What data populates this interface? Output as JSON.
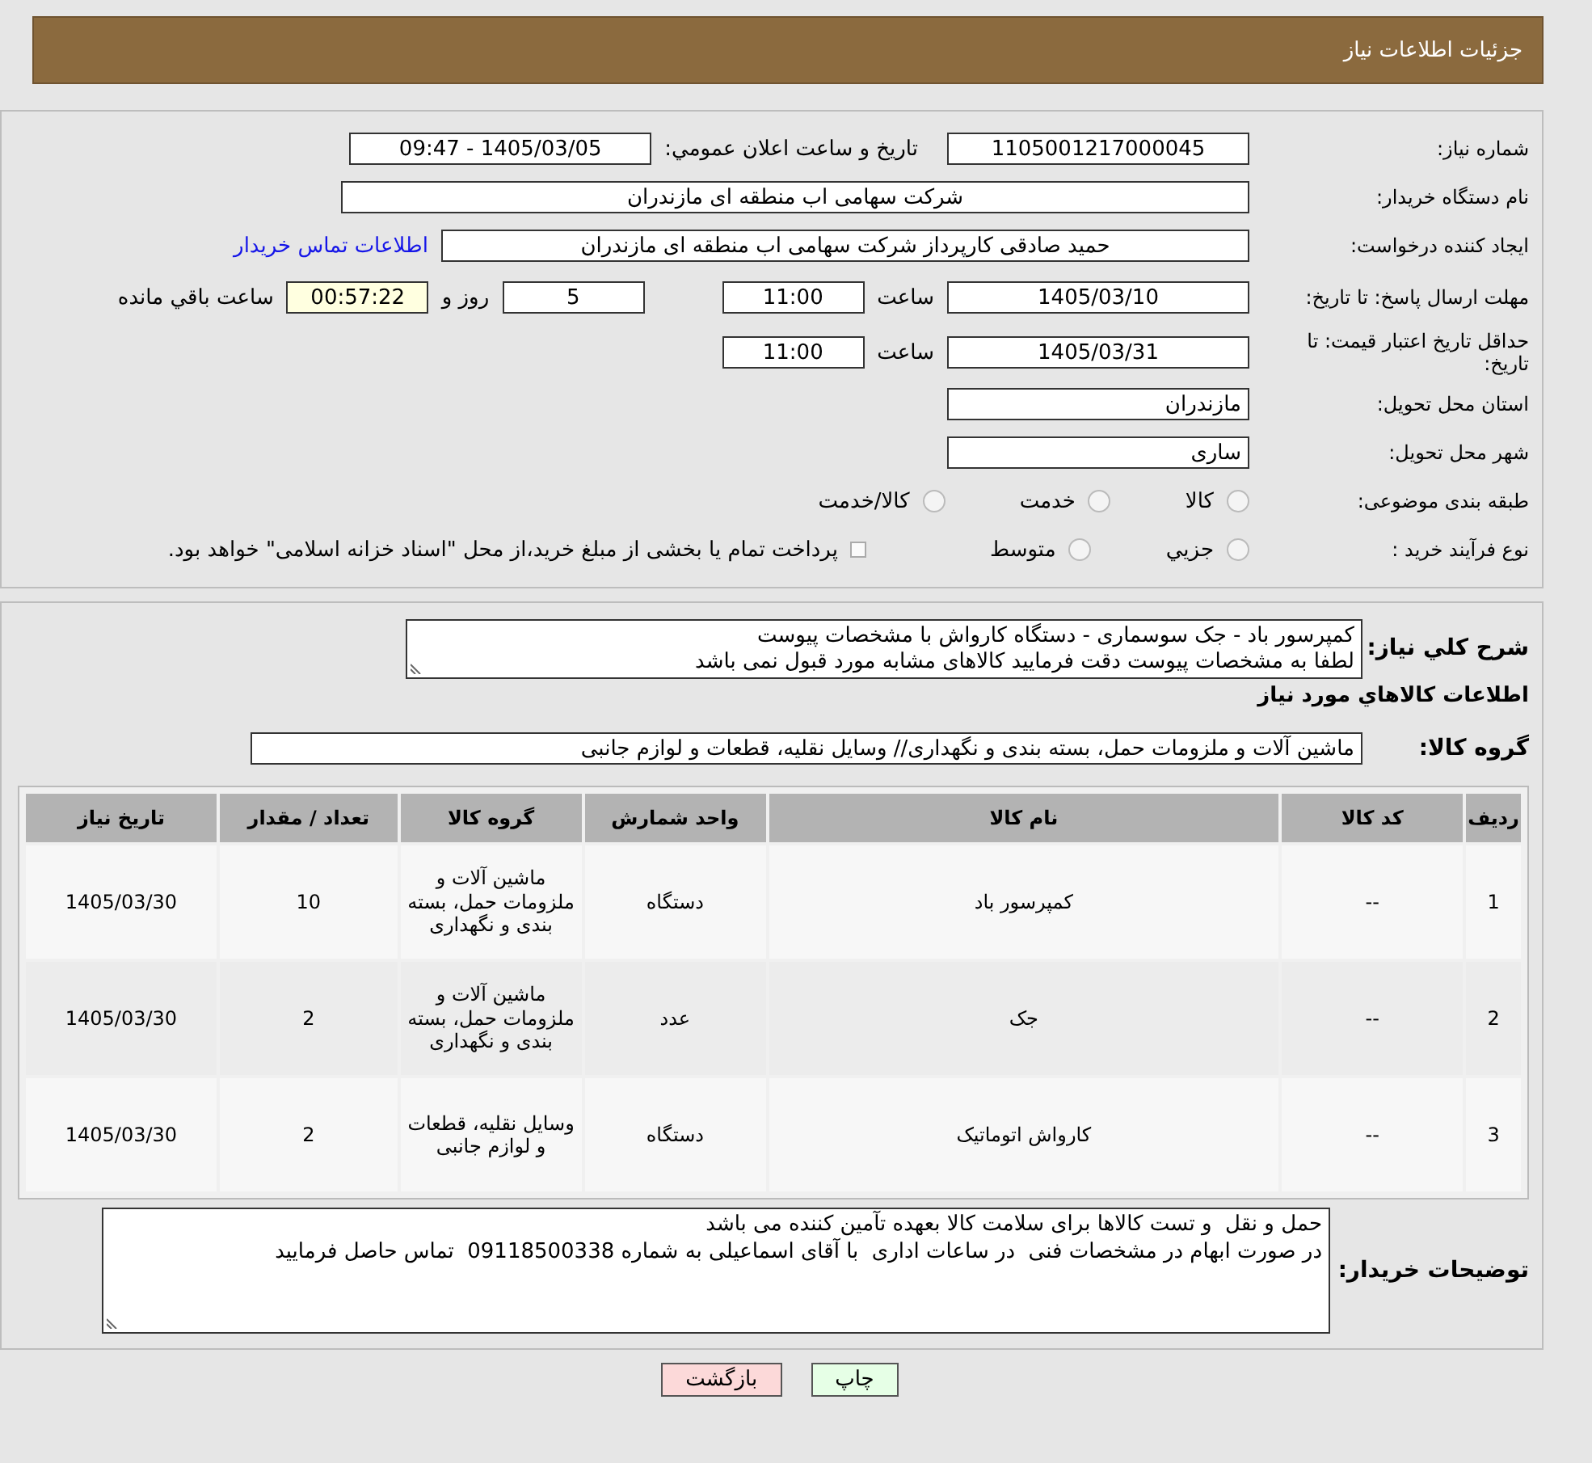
{
  "header": {
    "title": "جزئیات اطلاعات نیاز"
  },
  "need_info": {
    "need_number": {
      "label": "شماره نیاز:",
      "value": "1105001217000045"
    },
    "announce": {
      "label": "تاریخ و ساعت اعلان عمومي:",
      "value": "1405/03/05 - 09:47"
    },
    "buyer_org": {
      "label": "نام دستگاه خریدار:",
      "value": "شرکت سهامی اب منطقه ای مازندران"
    },
    "requester": {
      "label": "ایجاد کننده درخواست:",
      "value": "حمید  صادقی کارپرداز شرکت سهامی اب منطقه ای مازندران",
      "link": "اطلاعات تماس خریدار"
    },
    "reply_deadline": {
      "label": "مهلت ارسال پاسخ: تا تاریخ:",
      "date": "1405/03/10",
      "time_label": "ساعت",
      "time": "11:00",
      "days": "5",
      "days_label": "روز و",
      "remaining": "00:57:22",
      "remaining_label": "ساعت باقي مانده"
    },
    "price_validity": {
      "label": "حداقل تاریخ اعتبار قیمت: تا تاریخ:",
      "date": "1405/03/31",
      "time_label": "ساعت",
      "time": "11:00"
    },
    "province": {
      "label": "استان محل تحویل:",
      "value": "مازندران"
    },
    "city": {
      "label": "شهر محل تحویل:",
      "value": "ساری"
    },
    "category": {
      "label": "طبقه بندی موضوعی:",
      "options": [
        {
          "label": "کالا",
          "selected": false
        },
        {
          "label": "خدمت",
          "selected": false
        },
        {
          "label": "کالا/خدمت",
          "selected": false
        }
      ]
    },
    "purchase_type": {
      "label": "نوع فرآیند خرید :",
      "options": [
        {
          "label": "جزيي",
          "selected": false
        },
        {
          "label": "متوسط",
          "selected": false
        }
      ],
      "note": {
        "text": "پرداخت تمام یا بخشی از مبلغ خرید،از محل \"اسناد خزانه اسلامی\" خواهد بود.",
        "checked": false
      }
    }
  },
  "goods": {
    "description": {
      "label": "شرح کلي نیاز:",
      "value": "کمپرسور باد - جک سوسماری - دستگاه کارواش با مشخصات پیوست\nلطفا به مشخصات پیوست دقت فرمایید کالاهای مشابه مورد قبول نمی باشد"
    },
    "section_title": "اطلاعات کالاهاي مورد نیاز",
    "goods_group": {
      "label": "گروه کالا:",
      "value": "ماشین آلات و ملزومات حمل، بسته بندی و نگهداری// وسایل نقلیه، قطعات و لوازم جانبی"
    },
    "table": {
      "columns": [
        "ردیف",
        "کد کالا",
        "نام کالا",
        "واحد شمارش",
        "گروه کالا",
        "تعداد / مقدار",
        "تاریخ نیاز"
      ],
      "rows": [
        [
          "1",
          "--",
          "کمپرسور باد",
          "دستگاه",
          "ماشین آلات و ملزومات حمل، بسته بندی و نگهداری",
          "10",
          "1405/03/30"
        ],
        [
          "2",
          "--",
          "جک",
          "عدد",
          "ماشین آلات و ملزومات حمل، بسته بندی و نگهداری",
          "2",
          "1405/03/30"
        ],
        [
          "3",
          "--",
          "کارواش اتوماتیک",
          "دستگاه",
          "وسایل نقلیه، قطعات و لوازم جانبی",
          "2",
          "1405/03/30"
        ]
      ]
    },
    "buyer_notes": {
      "label": "توضیحات خریدار:",
      "value": "حمل و نقل  و تست کالاها برای سلامت کالا بعهده تآمین کننده می باشد\nدر صورت ابهام در مشخصات فنی  در ساعات اداری  با آقای اسماعیلی به شماره 09118500338  تماس حاصل فرمایید"
    }
  },
  "buttons": [
    {
      "label": "چاپ",
      "kind": "print"
    },
    {
      "label": "بازگشت",
      "kind": "back"
    }
  ]
}
